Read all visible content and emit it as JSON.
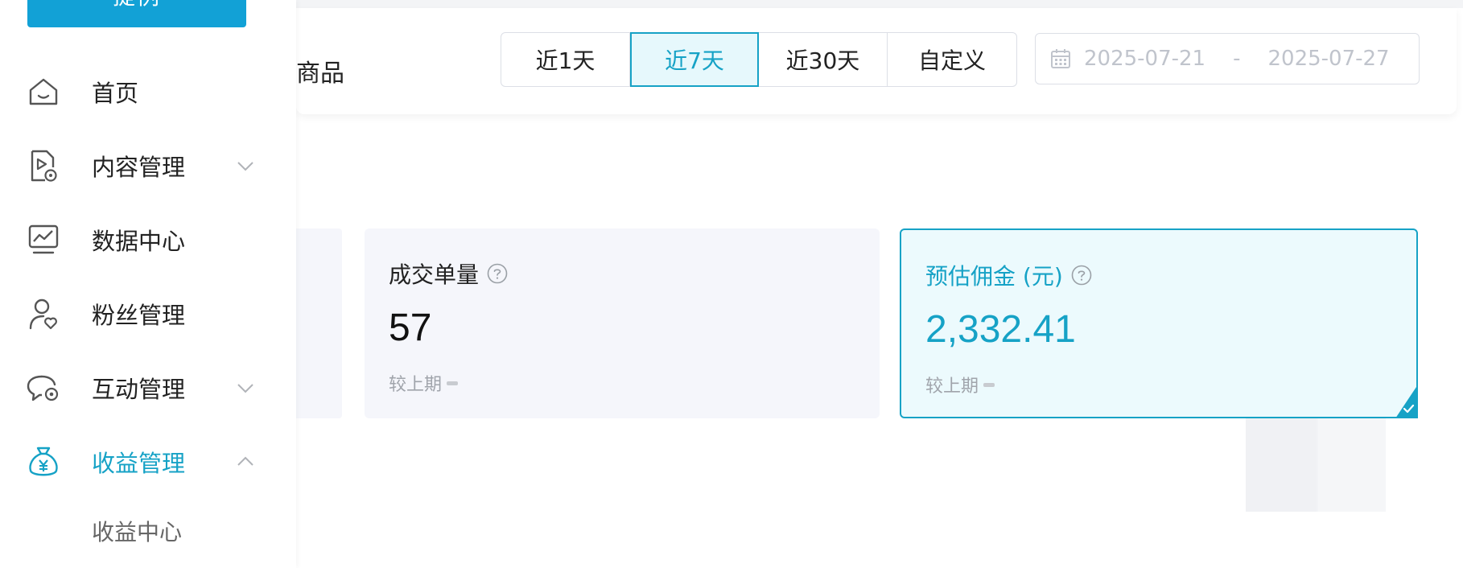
{
  "sidebar": {
    "top_button_label": "提例",
    "menu": [
      {
        "label": "首页",
        "icon": "home-icon"
      },
      {
        "label": "内容管理",
        "icon": "content-video-icon",
        "chevron": "down"
      },
      {
        "label": "数据中心",
        "icon": "chart-monitor-icon"
      },
      {
        "label": "粉丝管理",
        "icon": "fans-user-icon"
      },
      {
        "label": "互动管理",
        "icon": "chat-settings-icon",
        "chevron": "down"
      },
      {
        "label": "收益管理",
        "icon": "money-bag-icon",
        "chevron": "up",
        "active": true
      }
    ],
    "submenu": [
      {
        "label": "收益中心"
      }
    ]
  },
  "filter": {
    "title_partial": "商品",
    "ranges": [
      "近1天",
      "近7天",
      "近30天",
      "自定义"
    ],
    "active_range": "近7天",
    "date_start": "2025-07-21",
    "date_sep": "-",
    "date_end": "2025-07-27"
  },
  "metrics": [
    {
      "label": "成交单量",
      "value": "57",
      "compare": "较上期"
    },
    {
      "label": "预估佣金 (元)",
      "value": "2,332.41",
      "compare": "较上期",
      "selected": true
    }
  ],
  "colors": {
    "accent": "#16a2c6",
    "button": "#12a1d6",
    "card_bg": "#f5f6fb",
    "selected_bg": "#ecfafd"
  }
}
